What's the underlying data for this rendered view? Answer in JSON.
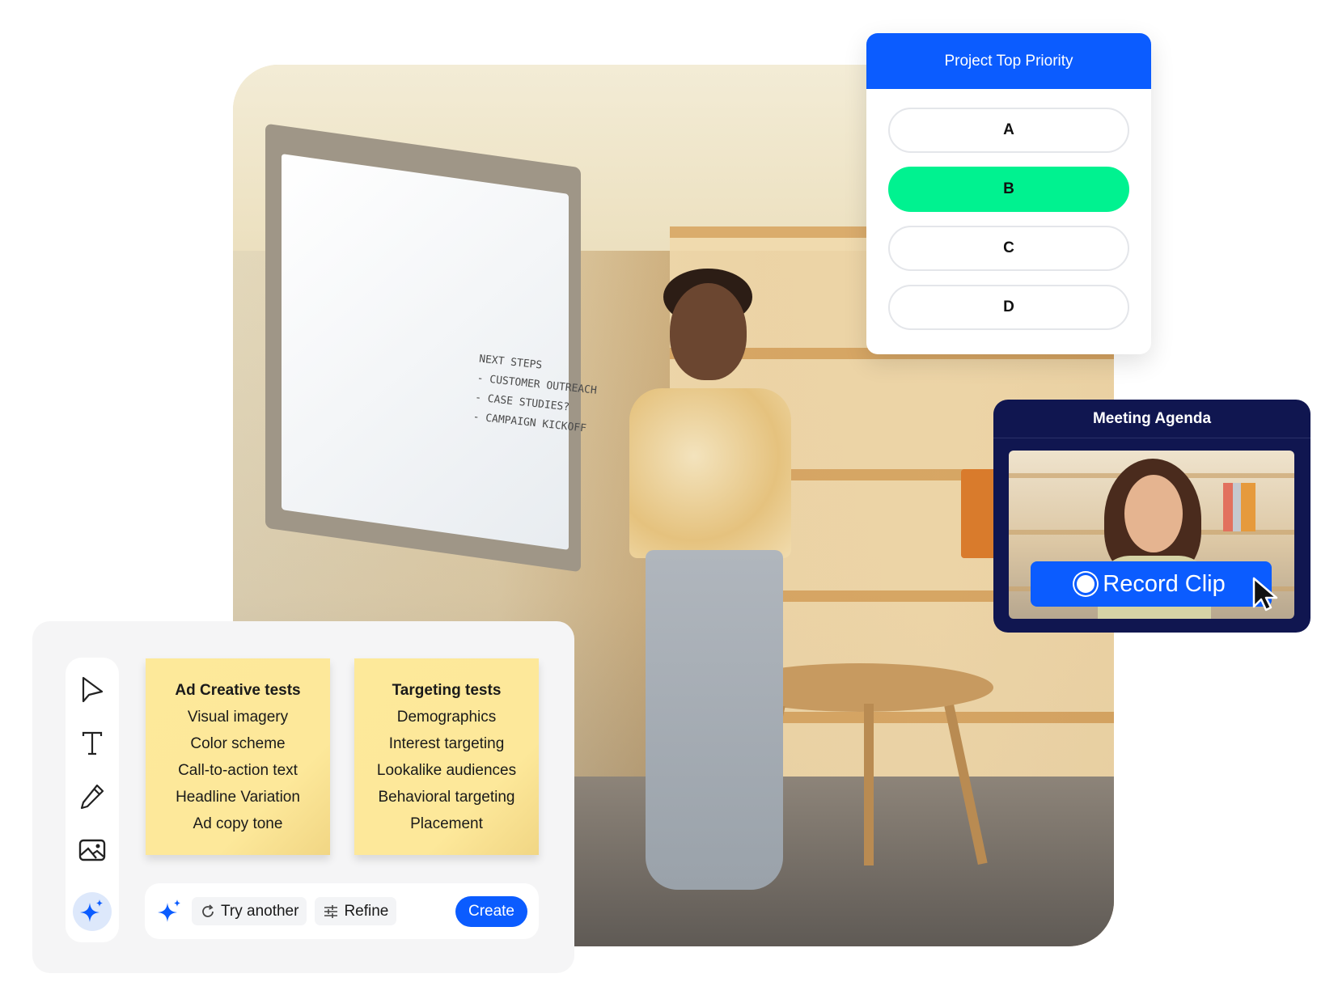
{
  "colors": {
    "brand_blue": "#0b5cff",
    "selected_green": "#00f290",
    "agenda_navy": "#101650",
    "sticky_yellow": "#fde99a"
  },
  "photo": {
    "whiteboard_notes": [
      "NEXT STEPS",
      "- CUSTOMER OUTREACH",
      "- CASE STUDIES?",
      "- CAMPAIGN KICKOFF"
    ]
  },
  "poll": {
    "title": "Project Top Priority",
    "options": [
      {
        "label": "A",
        "selected": false
      },
      {
        "label": "B",
        "selected": true
      },
      {
        "label": "C",
        "selected": false
      },
      {
        "label": "D",
        "selected": false
      }
    ]
  },
  "agenda": {
    "title": "Meeting Agenda",
    "record_label": "Record Clip",
    "record_icon": "record-circle-icon",
    "cursor_icon": "pointer-cursor-icon"
  },
  "whiteboard": {
    "tools": [
      {
        "name": "select-tool",
        "icon": "pointer-arrow-icon"
      },
      {
        "name": "text-tool",
        "icon": "text-t-icon"
      },
      {
        "name": "pen-tool",
        "icon": "pencil-icon"
      },
      {
        "name": "image-tool",
        "icon": "image-icon"
      },
      {
        "name": "ai-tool",
        "icon": "sparkle-icon",
        "active": true
      }
    ],
    "stickies": [
      {
        "title": "Ad Creative tests",
        "items": [
          "Visual imagery",
          "Color scheme",
          "Call-to-action text",
          "Headline Variation",
          "Ad copy tone"
        ]
      },
      {
        "title": "Targeting tests",
        "items": [
          "Demographics",
          "Interest targeting",
          "Lookalike audiences",
          "Behavioral targeting",
          "Placement"
        ]
      }
    ],
    "ai_bar": {
      "sparkle_icon": "sparkle-icon",
      "try_another_label": "Try another",
      "refine_label": "Refine",
      "create_label": "Create"
    }
  }
}
